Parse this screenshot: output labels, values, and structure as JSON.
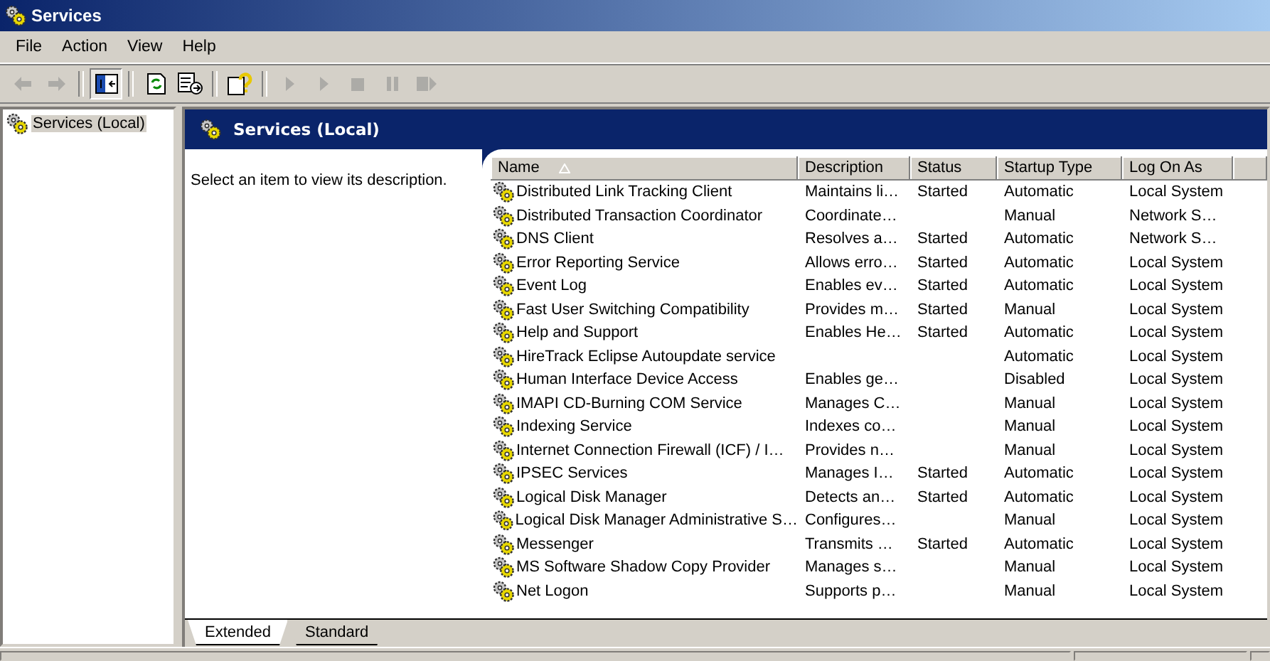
{
  "window": {
    "title": "Services"
  },
  "menu": [
    "File",
    "Action",
    "View",
    "Help"
  ],
  "toolbar": [
    {
      "kind": "back",
      "disabled": true
    },
    {
      "kind": "forward",
      "disabled": true
    },
    {
      "kind": "sep"
    },
    {
      "kind": "tree",
      "disabled": false
    },
    {
      "kind": "sep"
    },
    {
      "kind": "refresh",
      "disabled": false
    },
    {
      "kind": "export",
      "disabled": false
    },
    {
      "kind": "sep"
    },
    {
      "kind": "help",
      "disabled": false
    },
    {
      "kind": "sep"
    },
    {
      "kind": "play",
      "disabled": true
    },
    {
      "kind": "play",
      "disabled": true
    },
    {
      "kind": "stop",
      "disabled": true
    },
    {
      "kind": "pause",
      "disabled": true
    },
    {
      "kind": "restart",
      "disabled": true
    }
  ],
  "tree": [
    {
      "label": "Services (Local)",
      "selected": true
    }
  ],
  "panel": {
    "title": "Services (Local)",
    "description": "Select an item to view its description."
  },
  "table": {
    "columns": [
      "Name",
      "Description",
      "Status",
      "Startup Type",
      "Log On As"
    ],
    "rows": [
      [
        "Distributed Link Tracking Client",
        "Maintains li…",
        "Started",
        "Automatic",
        "Local System"
      ],
      [
        "Distributed Transaction Coordinator",
        "Coordinate…",
        "",
        "Manual",
        "Network S…"
      ],
      [
        "DNS Client",
        "Resolves a…",
        "Started",
        "Automatic",
        "Network S…"
      ],
      [
        "Error Reporting Service",
        "Allows erro…",
        "Started",
        "Automatic",
        "Local System"
      ],
      [
        "Event Log",
        "Enables ev…",
        "Started",
        "Automatic",
        "Local System"
      ],
      [
        "Fast User Switching Compatibility",
        "Provides m…",
        "Started",
        "Manual",
        "Local System"
      ],
      [
        "Help and Support",
        "Enables He…",
        "Started",
        "Automatic",
        "Local System"
      ],
      [
        "HireTrack Eclipse Autoupdate service",
        "",
        "",
        "Automatic",
        "Local System"
      ],
      [
        "Human Interface Device Access",
        "Enables ge…",
        "",
        "Disabled",
        "Local System"
      ],
      [
        "IMAPI CD-Burning COM Service",
        "Manages C…",
        "",
        "Manual",
        "Local System"
      ],
      [
        "Indexing Service",
        "Indexes co…",
        "",
        "Manual",
        "Local System"
      ],
      [
        "Internet Connection Firewall (ICF) / I…",
        "Provides n…",
        "",
        "Manual",
        "Local System"
      ],
      [
        "IPSEC Services",
        "Manages I…",
        "Started",
        "Automatic",
        "Local System"
      ],
      [
        "Logical Disk Manager",
        "Detects an…",
        "Started",
        "Automatic",
        "Local System"
      ],
      [
        "Logical Disk Manager Administrative S…",
        "Configures…",
        "",
        "Manual",
        "Local System"
      ],
      [
        "Messenger",
        "Transmits …",
        "Started",
        "Automatic",
        "Local System"
      ],
      [
        "MS Software Shadow Copy Provider",
        "Manages s…",
        "",
        "Manual",
        "Local System"
      ],
      [
        "Net Logon",
        "Supports p…",
        "",
        "Manual",
        "Local System"
      ]
    ]
  },
  "tabs": [
    {
      "label": "Extended",
      "selected": true
    },
    {
      "label": "Standard",
      "selected": false
    }
  ]
}
